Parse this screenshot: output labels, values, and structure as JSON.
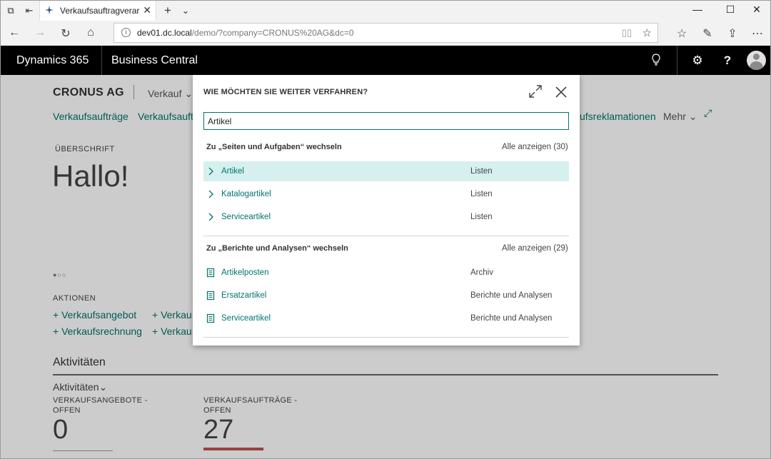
{
  "browser": {
    "tab_title": "Verkaufsauftragverarbei",
    "url_host": "dev01.dc.local",
    "url_path": "/demo/?company=CRONUS%20AG&dc=0"
  },
  "app": {
    "brand": "Dynamics 365",
    "product": "Business Central"
  },
  "page": {
    "company": "CRONUS AG",
    "menu": "Verkauf",
    "sublinks": [
      "Verkaufsaufträge",
      "Verkaufsauftr",
      "ufsreklamationen"
    ],
    "more": "Mehr",
    "headline_caption": "ÜBERSCHRIFT",
    "headline": "Hallo!",
    "actions_caption": "AKTIONEN",
    "actions": [
      "Verkaufsangebot",
      "Verkau",
      "Verkaufsrechnung",
      "Verkau"
    ],
    "activities_title": "Aktivitäten",
    "activities_sub": "Aktivitäten",
    "cues": [
      {
        "caption_line1": "VERKAUFSANGEBOTE -",
        "caption_line2": "OFFEN",
        "value": "0"
      },
      {
        "caption_line1": "VERKAUFSAUFTRÄGE -",
        "caption_line2": "OFFEN",
        "value": "27"
      }
    ]
  },
  "dialog": {
    "title": "WIE MÖCHTEN SIE WEITER VERFAHREN?",
    "search_value": "Artikel",
    "section1": {
      "heading": "Zu „Seiten und Aufgaben“ wechseln",
      "show_all": "Alle anzeigen (30)",
      "items": [
        {
          "name": "Artikel",
          "type": "Listen",
          "icon": "chevron-right-icon"
        },
        {
          "name": "Katalogartikel",
          "type": "Listen",
          "icon": "chevron-right-icon"
        },
        {
          "name": "Serviceartikel",
          "type": "Listen",
          "icon": "chevron-right-icon"
        }
      ]
    },
    "section2": {
      "heading": "Zu „Berichte und Analysen“ wechseln",
      "show_all": "Alle anzeigen (29)",
      "items": [
        {
          "name": "Artikelposten",
          "type": "Archiv",
          "icon": "report-icon"
        },
        {
          "name": "Ersatzartikel",
          "type": "Berichte und Analysen",
          "icon": "report-icon"
        },
        {
          "name": "Serviceartikel",
          "type": "Berichte und Analysen",
          "icon": "report-icon"
        }
      ]
    }
  },
  "colors": {
    "accent": "#00736c",
    "selected_row": "#d6f0f0",
    "cue_bar_red": "#c0504d"
  }
}
